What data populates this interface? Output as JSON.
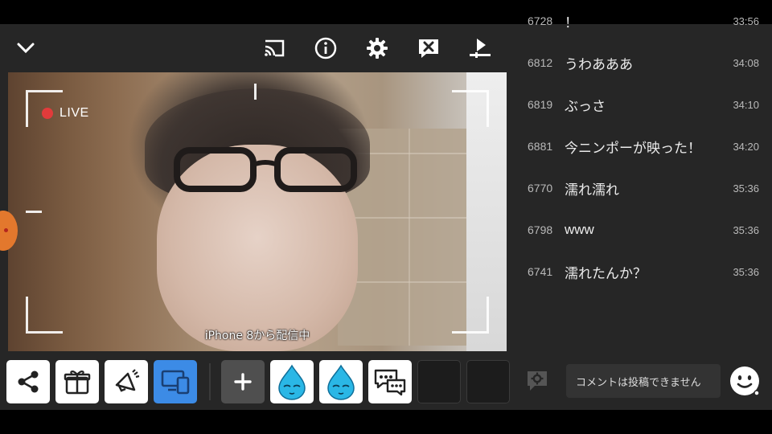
{
  "video": {
    "live_label": "LIVE",
    "source_text": "iPhone 8から配信中"
  },
  "toolbar": {
    "icons": [
      "chevron-down-icon",
      "cast-icon",
      "info-icon",
      "gear-icon",
      "close-comment-icon",
      "upload-icon"
    ]
  },
  "tray": {
    "tiles": [
      "share-icon",
      "gift-icon",
      "megaphone-icon",
      "screen-devices-icon",
      "add-icon",
      "drop-character-icon",
      "drop-character-icon",
      "comment-bubbles-icon",
      "empty-slot",
      "empty-slot"
    ],
    "accent_color": "#3c8be6"
  },
  "comments": [
    {
      "num": "6728",
      "msg": "！",
      "time": "33:56"
    },
    {
      "num": "6812",
      "msg": "うわあああ",
      "time": "34:08"
    },
    {
      "num": "6819",
      "msg": "ぶっさ",
      "time": "34:10"
    },
    {
      "num": "6881",
      "msg": "今ニンポーが映った！",
      "time": "34:20"
    },
    {
      "num": "6770",
      "msg": "濡れ濡れ",
      "time": "35:36"
    },
    {
      "num": "6798",
      "msg": "www",
      "time": "35:36"
    },
    {
      "num": "6741",
      "msg": "濡れたんか？",
      "time": "35:36"
    }
  ],
  "composer": {
    "placeholder": "コメントは投稿できません"
  }
}
